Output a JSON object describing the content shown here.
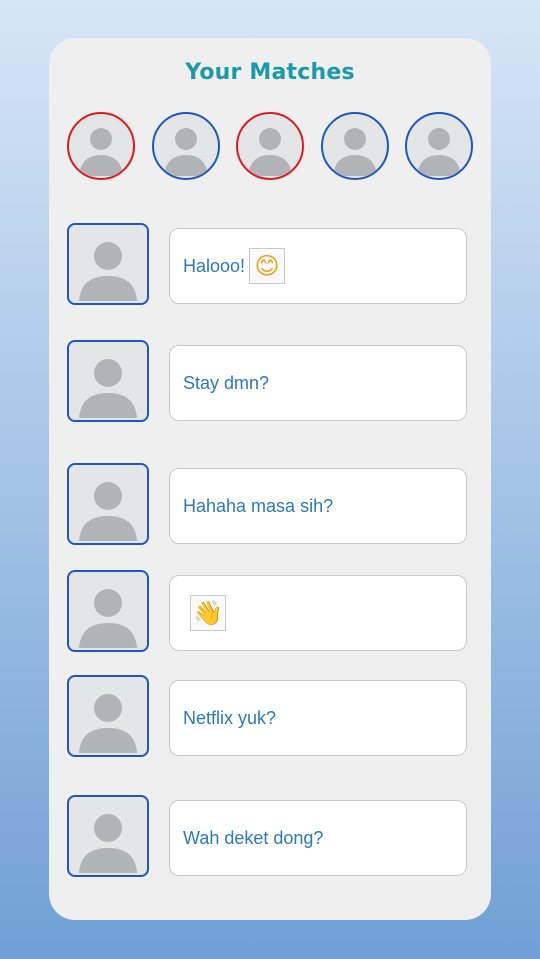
{
  "header": {
    "title": "Your Matches"
  },
  "colors": {
    "title": "#1a9aa8",
    "message_text": "#2b7ab8",
    "ring_red": "#e0191f",
    "ring_blue": "#1e56c6",
    "card_background": "#efefef"
  },
  "matches": [
    {
      "ring": "red",
      "icon": "person-icon"
    },
    {
      "ring": "blue",
      "icon": "person-icon"
    },
    {
      "ring": "red",
      "icon": "person-icon"
    },
    {
      "ring": "blue",
      "icon": "person-icon"
    },
    {
      "ring": "blue",
      "icon": "person-icon"
    }
  ],
  "chats": [
    {
      "text": "Halooo!",
      "emoji": "😊",
      "emoji_icon": "smiling-face-icon"
    },
    {
      "text": "Stay dmn?",
      "emoji": "",
      "emoji_icon": ""
    },
    {
      "text": "Hahaha masa sih?",
      "emoji": "",
      "emoji_icon": ""
    },
    {
      "text": "",
      "emoji": "👋",
      "emoji_icon": "waving-hand-icon"
    },
    {
      "text": "Netflix yuk?",
      "emoji": "",
      "emoji_icon": ""
    },
    {
      "text": "Wah deket dong?",
      "emoji": "",
      "emoji_icon": ""
    }
  ]
}
